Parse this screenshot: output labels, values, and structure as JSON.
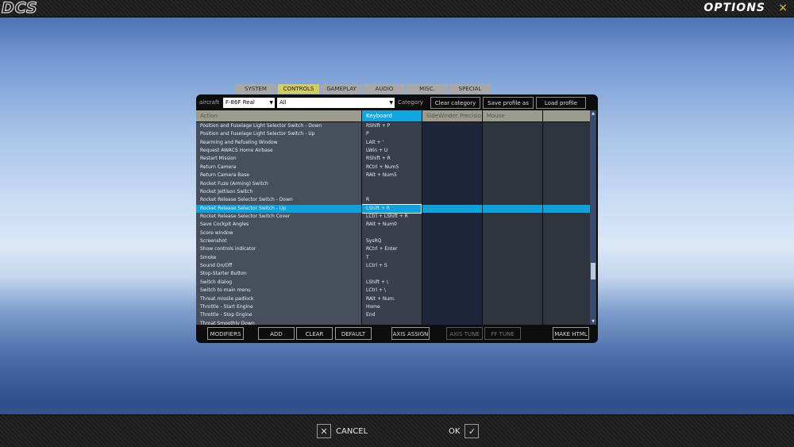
{
  "topbar": {
    "logo": "DCS",
    "title": "OPTIONS",
    "close": "×"
  },
  "tabs": [
    "SYSTEM",
    "CONTROLS",
    "GAMEPLAY",
    "AUDIO",
    "MISC.",
    "SPECIAL"
  ],
  "active_tab": "CONTROLS",
  "toolbar": {
    "aircraft_label": "aircraft",
    "aircraft_value": "F-86F Real",
    "category_value": "All",
    "category_label": "Category",
    "clear_category": "Clear category",
    "save_profile": "Save profile as",
    "load_profile": "Load profile"
  },
  "columns": [
    "Action",
    "Keyboard",
    "SideWinder Precisio",
    "Mouse"
  ],
  "rows": [
    {
      "action": "Position and Fuselage Light Selector Switch - Down",
      "keyboard": "RShift + P"
    },
    {
      "action": "Position and Fuselage Light Selector Switch - Up",
      "keyboard": "P"
    },
    {
      "action": "Rearming and Refueling Window",
      "keyboard": "LAlt + '"
    },
    {
      "action": "Request AWACS Home Airbase",
      "keyboard": "LWin + U"
    },
    {
      "action": "Restart Mission",
      "keyboard": "RShift + R"
    },
    {
      "action": "Return Camera",
      "keyboard": "RCtrl + Num5"
    },
    {
      "action": "Return Camera Base",
      "keyboard": "RAlt + Num5"
    },
    {
      "action": "Rocket Fuze (Arming) Switch",
      "keyboard": ""
    },
    {
      "action": "Rocket Jettison Switch",
      "keyboard": ""
    },
    {
      "action": "Rocket Release Selector Switch - Down",
      "keyboard": "R"
    },
    {
      "action": "Rocket Release Selector Switch - Up",
      "keyboard": "LShift + R"
    },
    {
      "action": "Rocket Release Selector Switch Cover",
      "keyboard": "LCtrl + LShift + R"
    },
    {
      "action": "Save Cockpit Angles",
      "keyboard": "RAlt + Num0"
    },
    {
      "action": "Score window",
      "keyboard": ""
    },
    {
      "action": "Screenshot",
      "keyboard": "SysRQ"
    },
    {
      "action": "Show controls indicator",
      "keyboard": "RCtrl + Enter"
    },
    {
      "action": "Smoke",
      "keyboard": "T"
    },
    {
      "action": "Sound On/Off",
      "keyboard": "LCtrl + S"
    },
    {
      "action": "Stop-Starter Button",
      "keyboard": ""
    },
    {
      "action": "Switch dialog",
      "keyboard": "LShift + \\"
    },
    {
      "action": "Switch to main menu",
      "keyboard": "LCtrl + \\"
    },
    {
      "action": "Threat missile padlock",
      "keyboard": "RAlt + Num."
    },
    {
      "action": "Throttle - Start Engine",
      "keyboard": "Home"
    },
    {
      "action": "Throttle - Stop Engine",
      "keyboard": "End"
    },
    {
      "action": "Throat Smoothly Down",
      "keyboard": ""
    }
  ],
  "selected_row": 10,
  "buttons": {
    "modifiers": "MODIFIERS",
    "add": "ADD",
    "clear": "CLEAR",
    "default": "DEFAULT",
    "axis_assign": "AXIS ASSIGN",
    "axis_tune": "AXIS TUNE",
    "ff_tune": "FF TUNE",
    "make_html": "MAKE HTML"
  },
  "footer": {
    "cancel": "CANCEL",
    "ok": "OK"
  }
}
